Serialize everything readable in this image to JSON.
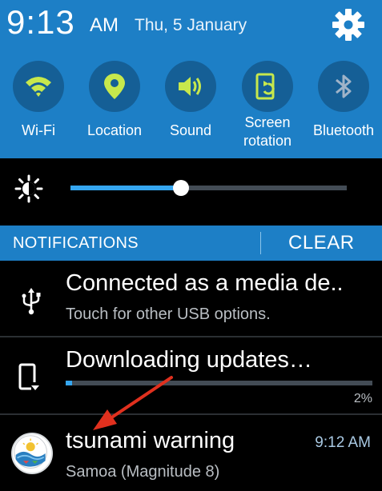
{
  "status_bar": {
    "time": "9:13",
    "ampm": "AM",
    "date": "Thu, 5 January",
    "settings_icon": "gear-icon"
  },
  "quick_settings": [
    {
      "label": "Wi-Fi",
      "icon": "wifi-icon",
      "state": "on"
    },
    {
      "label": "Location",
      "icon": "location-icon",
      "state": "on"
    },
    {
      "label": "Sound",
      "icon": "sound-icon",
      "state": "on"
    },
    {
      "label_line1": "Screen",
      "label_line2": "rotation",
      "icon": "screen-rotation-icon",
      "state": "on"
    },
    {
      "label": "Bluetooth",
      "icon": "bluetooth-icon",
      "state": "off"
    }
  ],
  "brightness": {
    "icon": "brightness-icon",
    "level": 0.4
  },
  "notifications_header": {
    "title": "NOTIFICATIONS",
    "clear_label": "CLEAR"
  },
  "notifications": [
    {
      "icon": "usb-icon",
      "title": "Connected as a media de..",
      "subtitle": "Touch for other USB options."
    },
    {
      "icon": "download-device-icon",
      "title": "Downloading updates…",
      "progress": 0.02,
      "progress_text": "2%"
    },
    {
      "icon": "tsunami-warning-app-icon",
      "title": "tsunami warning",
      "time": "9:12 AM",
      "subtitle": "Samoa (Magnitude 8)"
    }
  ],
  "colors": {
    "panel_blue": "#1d7fc6",
    "tile_circle": "#155f96",
    "active_icon": "#c7e84c",
    "inactive_icon": "#9fb3c8",
    "slider_fill": "#35a6f0",
    "annotation_arrow": "#e0301e"
  }
}
